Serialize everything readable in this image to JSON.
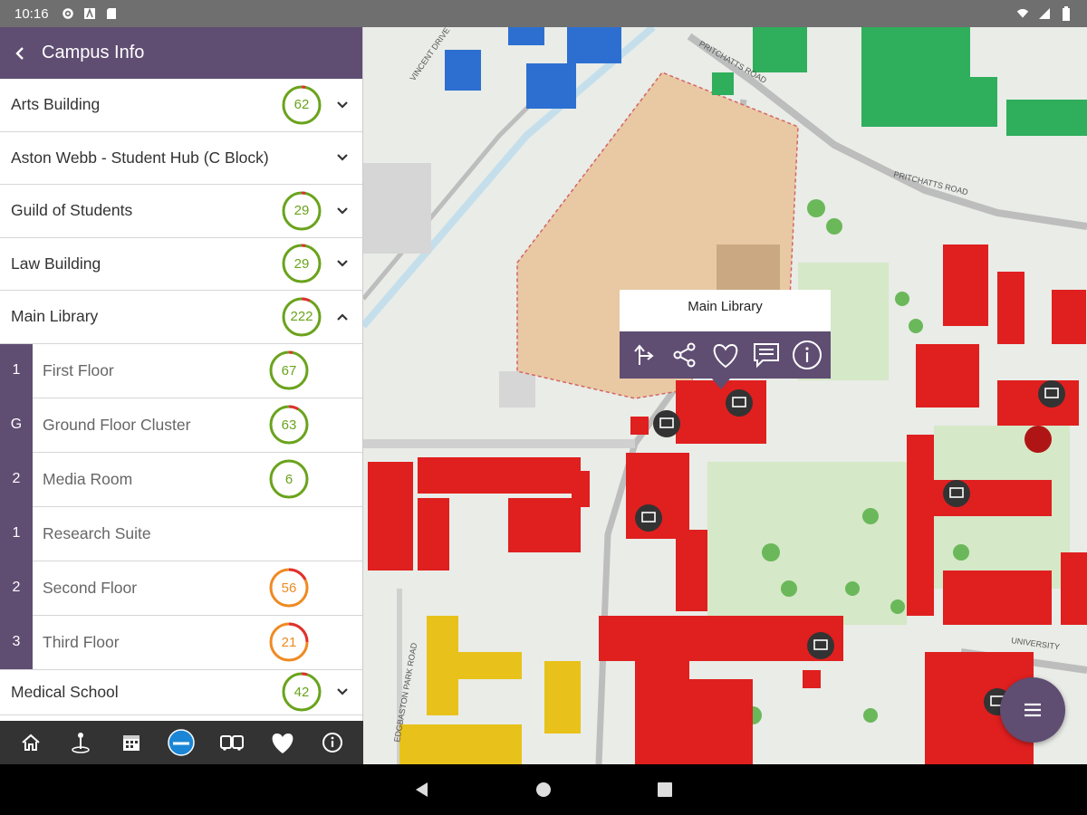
{
  "status_bar": {
    "time": "10:16",
    "icons": [
      "gear-icon",
      "a-box-icon",
      "sd-card-icon"
    ],
    "right_icons": [
      "wifi-icon",
      "signal-icon",
      "battery-icon"
    ]
  },
  "panel": {
    "title": "Campus Info",
    "buildings": [
      {
        "name": "Arts Building",
        "count": "62",
        "expanded": false
      },
      {
        "name": "Aston Webb - Student Hub (C Block)",
        "count": "",
        "expanded": false
      },
      {
        "name": "Guild of Students",
        "count": "29",
        "expanded": false
      },
      {
        "name": "Law Building",
        "count": "29",
        "expanded": false
      },
      {
        "name": "Main Library",
        "count": "222",
        "expanded": true
      }
    ],
    "floors": [
      {
        "floor": "1",
        "name": "First Floor",
        "count": "67",
        "color": "green"
      },
      {
        "floor": "G",
        "name": "Ground Floor Cluster",
        "count": "63",
        "color": "green"
      },
      {
        "floor": "2",
        "name": "Media Room",
        "count": "6",
        "color": "green"
      },
      {
        "floor": "1",
        "name": "Research Suite",
        "count": "",
        "color": ""
      },
      {
        "floor": "2",
        "name": "Second Floor",
        "count": "56",
        "color": "orange"
      },
      {
        "floor": "3",
        "name": "Third Floor",
        "count": "21",
        "color": "orange"
      }
    ],
    "after": [
      {
        "name": "Medical School",
        "count": "42",
        "expanded": false
      }
    ]
  },
  "toolbar": [
    "home-icon",
    "pin-icon",
    "calendar-icon",
    "logo-icon",
    "bus-icon",
    "heart-icon",
    "info-icon"
  ],
  "map": {
    "popup_title": "Main Library",
    "popup_actions": [
      "directions-icon",
      "share-icon",
      "heart-icon",
      "comment-icon",
      "info-icon"
    ],
    "street_labels": [
      "VINCENT DRIVE",
      "PRITCHATTS ROAD",
      "PRITCHATTS ROAD",
      "UNIVERSITY",
      "EDGBASTON PARK ROAD"
    ]
  },
  "colors": {
    "accent": "#5f4d72",
    "green_badge": "#6aa31c",
    "orange_badge": "#ef8a22",
    "building_red": "#e01f1f",
    "building_green": "#2fae5c",
    "building_blue": "#2d6fd1",
    "building_yellow": "#e8c21a"
  }
}
